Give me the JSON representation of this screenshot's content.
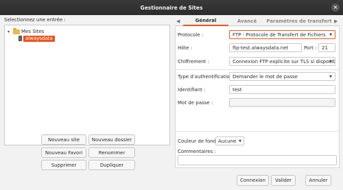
{
  "window": {
    "title": "Gestionnaire de Sites",
    "close_glyph": "×"
  },
  "left": {
    "label": "Selectionnez une entrée :",
    "tree": {
      "root": {
        "label": "Mes Sites",
        "expanded_glyph": "▾"
      },
      "site": {
        "label": "alwaysdata",
        "selected": true
      }
    },
    "buttons": {
      "new_site": "Nouveau site",
      "new_folder": "Nouveau dossier",
      "new_bookmark": "Nouveau Favori",
      "rename": "Renommer",
      "delete": "Supprimer",
      "duplicate": "Dupliquer"
    }
  },
  "tabs": {
    "prev_glyph": "◀",
    "next_glyph": "▶",
    "items": [
      {
        "label": "Général",
        "active": true
      },
      {
        "label": "Avancé",
        "active": false
      },
      {
        "label": "Paramètres de transfert",
        "active": false
      }
    ]
  },
  "general": {
    "protocol": {
      "label": "Protocole :",
      "value": "FTP - Protocole de Transfert de Fichiers"
    },
    "host": {
      "label": "Hôte :",
      "value": "ftp-test.alwaysdata.net"
    },
    "port": {
      "label": "Port :",
      "value": "21"
    },
    "encryption": {
      "label": "Chiffrement :",
      "value": "Connexion FTP explicite sur TLS si disponible"
    },
    "auth_type": {
      "label": "Type d'authentification :",
      "value": "Demander le mot de passe"
    },
    "user": {
      "label": "Identifiant :",
      "value": "test"
    },
    "password": {
      "label": "Mot de passe :",
      "value": ""
    },
    "bg_color": {
      "label": "Couleur de fond :",
      "value": "Aucune"
    },
    "comments": {
      "label": "Commentaires :",
      "value": ""
    }
  },
  "footer": {
    "connect": "Connexion",
    "ok": "Valider",
    "cancel": "Annuler"
  },
  "colors": {
    "accent": "#e95420",
    "titlebar": "#2c2c2c"
  }
}
